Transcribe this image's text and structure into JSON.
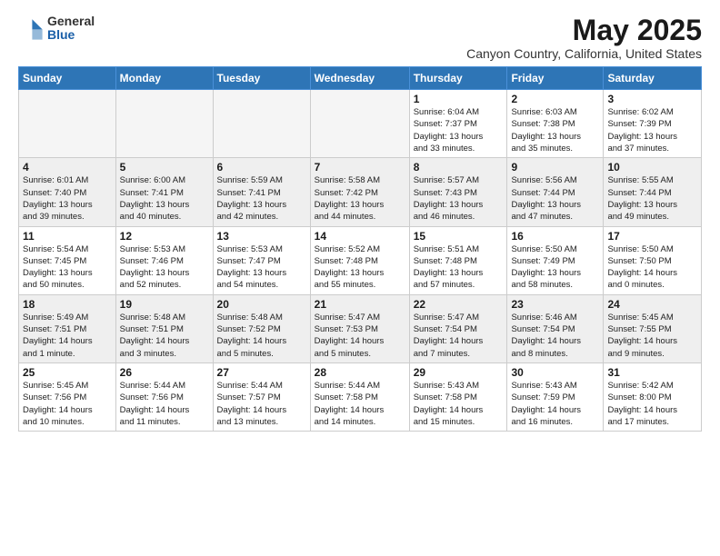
{
  "header": {
    "logo_general": "General",
    "logo_blue": "Blue",
    "month_title": "May 2025",
    "location": "Canyon Country, California, United States"
  },
  "weekdays": [
    "Sunday",
    "Monday",
    "Tuesday",
    "Wednesday",
    "Thursday",
    "Friday",
    "Saturday"
  ],
  "weeks": [
    [
      {
        "day": "",
        "info": ""
      },
      {
        "day": "",
        "info": ""
      },
      {
        "day": "",
        "info": ""
      },
      {
        "day": "",
        "info": ""
      },
      {
        "day": "1",
        "info": "Sunrise: 6:04 AM\nSunset: 7:37 PM\nDaylight: 13 hours\nand 33 minutes."
      },
      {
        "day": "2",
        "info": "Sunrise: 6:03 AM\nSunset: 7:38 PM\nDaylight: 13 hours\nand 35 minutes."
      },
      {
        "day": "3",
        "info": "Sunrise: 6:02 AM\nSunset: 7:39 PM\nDaylight: 13 hours\nand 37 minutes."
      }
    ],
    [
      {
        "day": "4",
        "info": "Sunrise: 6:01 AM\nSunset: 7:40 PM\nDaylight: 13 hours\nand 39 minutes."
      },
      {
        "day": "5",
        "info": "Sunrise: 6:00 AM\nSunset: 7:41 PM\nDaylight: 13 hours\nand 40 minutes."
      },
      {
        "day": "6",
        "info": "Sunrise: 5:59 AM\nSunset: 7:41 PM\nDaylight: 13 hours\nand 42 minutes."
      },
      {
        "day": "7",
        "info": "Sunrise: 5:58 AM\nSunset: 7:42 PM\nDaylight: 13 hours\nand 44 minutes."
      },
      {
        "day": "8",
        "info": "Sunrise: 5:57 AM\nSunset: 7:43 PM\nDaylight: 13 hours\nand 46 minutes."
      },
      {
        "day": "9",
        "info": "Sunrise: 5:56 AM\nSunset: 7:44 PM\nDaylight: 13 hours\nand 47 minutes."
      },
      {
        "day": "10",
        "info": "Sunrise: 5:55 AM\nSunset: 7:44 PM\nDaylight: 13 hours\nand 49 minutes."
      }
    ],
    [
      {
        "day": "11",
        "info": "Sunrise: 5:54 AM\nSunset: 7:45 PM\nDaylight: 13 hours\nand 50 minutes."
      },
      {
        "day": "12",
        "info": "Sunrise: 5:53 AM\nSunset: 7:46 PM\nDaylight: 13 hours\nand 52 minutes."
      },
      {
        "day": "13",
        "info": "Sunrise: 5:53 AM\nSunset: 7:47 PM\nDaylight: 13 hours\nand 54 minutes."
      },
      {
        "day": "14",
        "info": "Sunrise: 5:52 AM\nSunset: 7:48 PM\nDaylight: 13 hours\nand 55 minutes."
      },
      {
        "day": "15",
        "info": "Sunrise: 5:51 AM\nSunset: 7:48 PM\nDaylight: 13 hours\nand 57 minutes."
      },
      {
        "day": "16",
        "info": "Sunrise: 5:50 AM\nSunset: 7:49 PM\nDaylight: 13 hours\nand 58 minutes."
      },
      {
        "day": "17",
        "info": "Sunrise: 5:50 AM\nSunset: 7:50 PM\nDaylight: 14 hours\nand 0 minutes."
      }
    ],
    [
      {
        "day": "18",
        "info": "Sunrise: 5:49 AM\nSunset: 7:51 PM\nDaylight: 14 hours\nand 1 minute."
      },
      {
        "day": "19",
        "info": "Sunrise: 5:48 AM\nSunset: 7:51 PM\nDaylight: 14 hours\nand 3 minutes."
      },
      {
        "day": "20",
        "info": "Sunrise: 5:48 AM\nSunset: 7:52 PM\nDaylight: 14 hours\nand 5 minutes."
      },
      {
        "day": "21",
        "info": "Sunrise: 5:47 AM\nSunset: 7:53 PM\nDaylight: 14 hours\nand 5 minutes."
      },
      {
        "day": "22",
        "info": "Sunrise: 5:47 AM\nSunset: 7:54 PM\nDaylight: 14 hours\nand 7 minutes."
      },
      {
        "day": "23",
        "info": "Sunrise: 5:46 AM\nSunset: 7:54 PM\nDaylight: 14 hours\nand 8 minutes."
      },
      {
        "day": "24",
        "info": "Sunrise: 5:45 AM\nSunset: 7:55 PM\nDaylight: 14 hours\nand 9 minutes."
      }
    ],
    [
      {
        "day": "25",
        "info": "Sunrise: 5:45 AM\nSunset: 7:56 PM\nDaylight: 14 hours\nand 10 minutes."
      },
      {
        "day": "26",
        "info": "Sunrise: 5:44 AM\nSunset: 7:56 PM\nDaylight: 14 hours\nand 11 minutes."
      },
      {
        "day": "27",
        "info": "Sunrise: 5:44 AM\nSunset: 7:57 PM\nDaylight: 14 hours\nand 13 minutes."
      },
      {
        "day": "28",
        "info": "Sunrise: 5:44 AM\nSunset: 7:58 PM\nDaylight: 14 hours\nand 14 minutes."
      },
      {
        "day": "29",
        "info": "Sunrise: 5:43 AM\nSunset: 7:58 PM\nDaylight: 14 hours\nand 15 minutes."
      },
      {
        "day": "30",
        "info": "Sunrise: 5:43 AM\nSunset: 7:59 PM\nDaylight: 14 hours\nand 16 minutes."
      },
      {
        "day": "31",
        "info": "Sunrise: 5:42 AM\nSunset: 8:00 PM\nDaylight: 14 hours\nand 17 minutes."
      }
    ]
  ]
}
